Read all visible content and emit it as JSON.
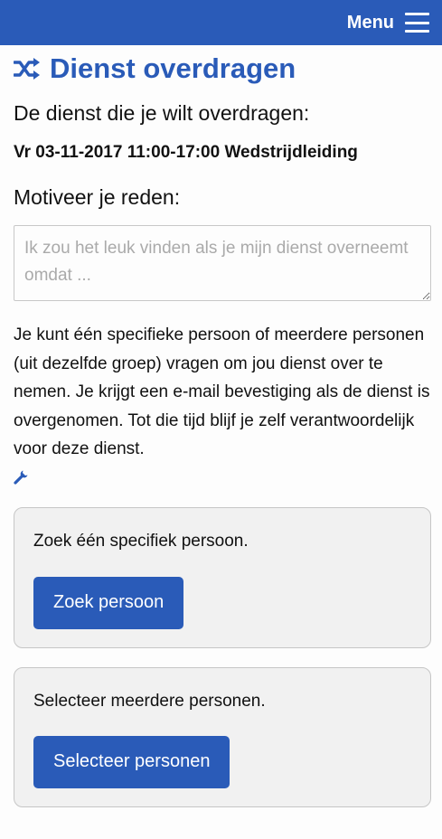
{
  "navbar": {
    "menu_label": "Menu",
    "menu_icon": "hamburger-icon",
    "background": "#2a5bb8"
  },
  "page": {
    "title_icon": "shuffle-icon",
    "title": "Dienst overdragen",
    "subheading": "De dienst die je wilt overdragen:",
    "shift": "Vr 03-11-2017 11:00-17:00 Wedstrijdleiding",
    "motivate_label": "Motiveer je reden:",
    "reason": {
      "value": "",
      "placeholder": "Ik zou het leuk vinden als je mijn dienst overneemt omdat ..."
    },
    "info": "Je kunt één specifieke persoon of meerdere personen (uit dezelfde groep) vragen om jou dienst over te nemen. Je krijgt een e-mail bevestiging als de dienst is overgenomen. Tot die tijd blijf je zelf verantwoordelijk voor deze dienst.",
    "info_icon": "wrench-icon"
  },
  "cards": {
    "single": {
      "text": "Zoek één specifiek persoon.",
      "button": "Zoek persoon"
    },
    "multiple": {
      "text": "Selecteer meerdere personen.",
      "button": "Selecteer personen"
    }
  },
  "colors": {
    "accent": "#2a5bb8",
    "card_bg": "#f1f1f1"
  }
}
